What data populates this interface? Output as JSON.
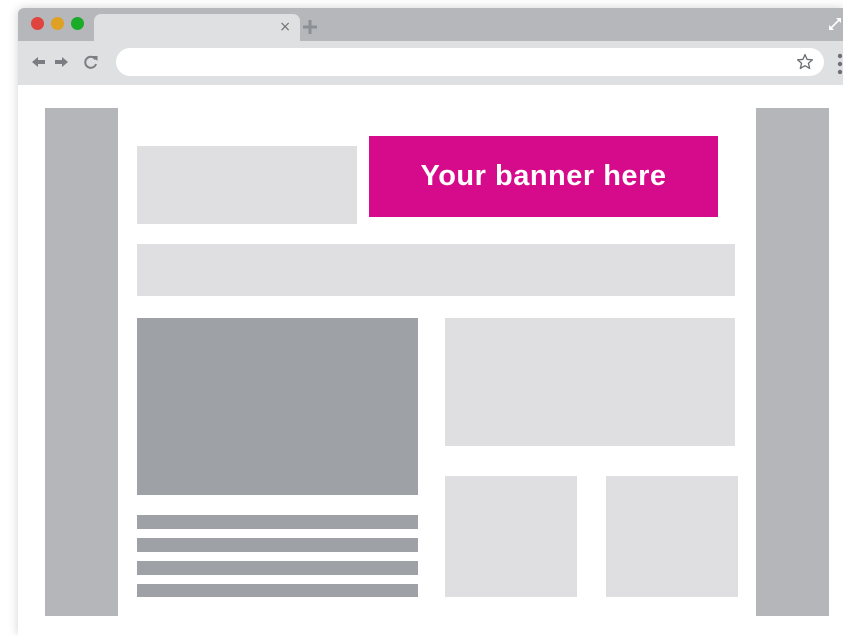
{
  "browser": {
    "tab": {
      "close_glyph": "×"
    },
    "icons": {
      "window_dots": [
        "close-dot",
        "minimize-dot",
        "maximize-dot"
      ],
      "new_tab": "plus-icon",
      "back": "arrow-left-icon",
      "forward": "arrow-right-icon",
      "reload": "reload-icon",
      "bookmark": "star-icon",
      "menu": "kebab-menu-icon",
      "expand": "expand-icon"
    },
    "address": {
      "value": ""
    }
  },
  "page": {
    "banner": {
      "label": "Your banner here"
    }
  },
  "colors": {
    "banner": "#d50b8b",
    "chrome": "#b5b7ba",
    "toolbar": "#dfe0e2",
    "placeholder_light": "#dfdfe1",
    "placeholder_mid": "#b5b6b9",
    "placeholder_dark": "#9ea1a5",
    "dot_red": "#e0443e",
    "dot_yellow": "#dea123",
    "dot_green": "#1aab29"
  }
}
